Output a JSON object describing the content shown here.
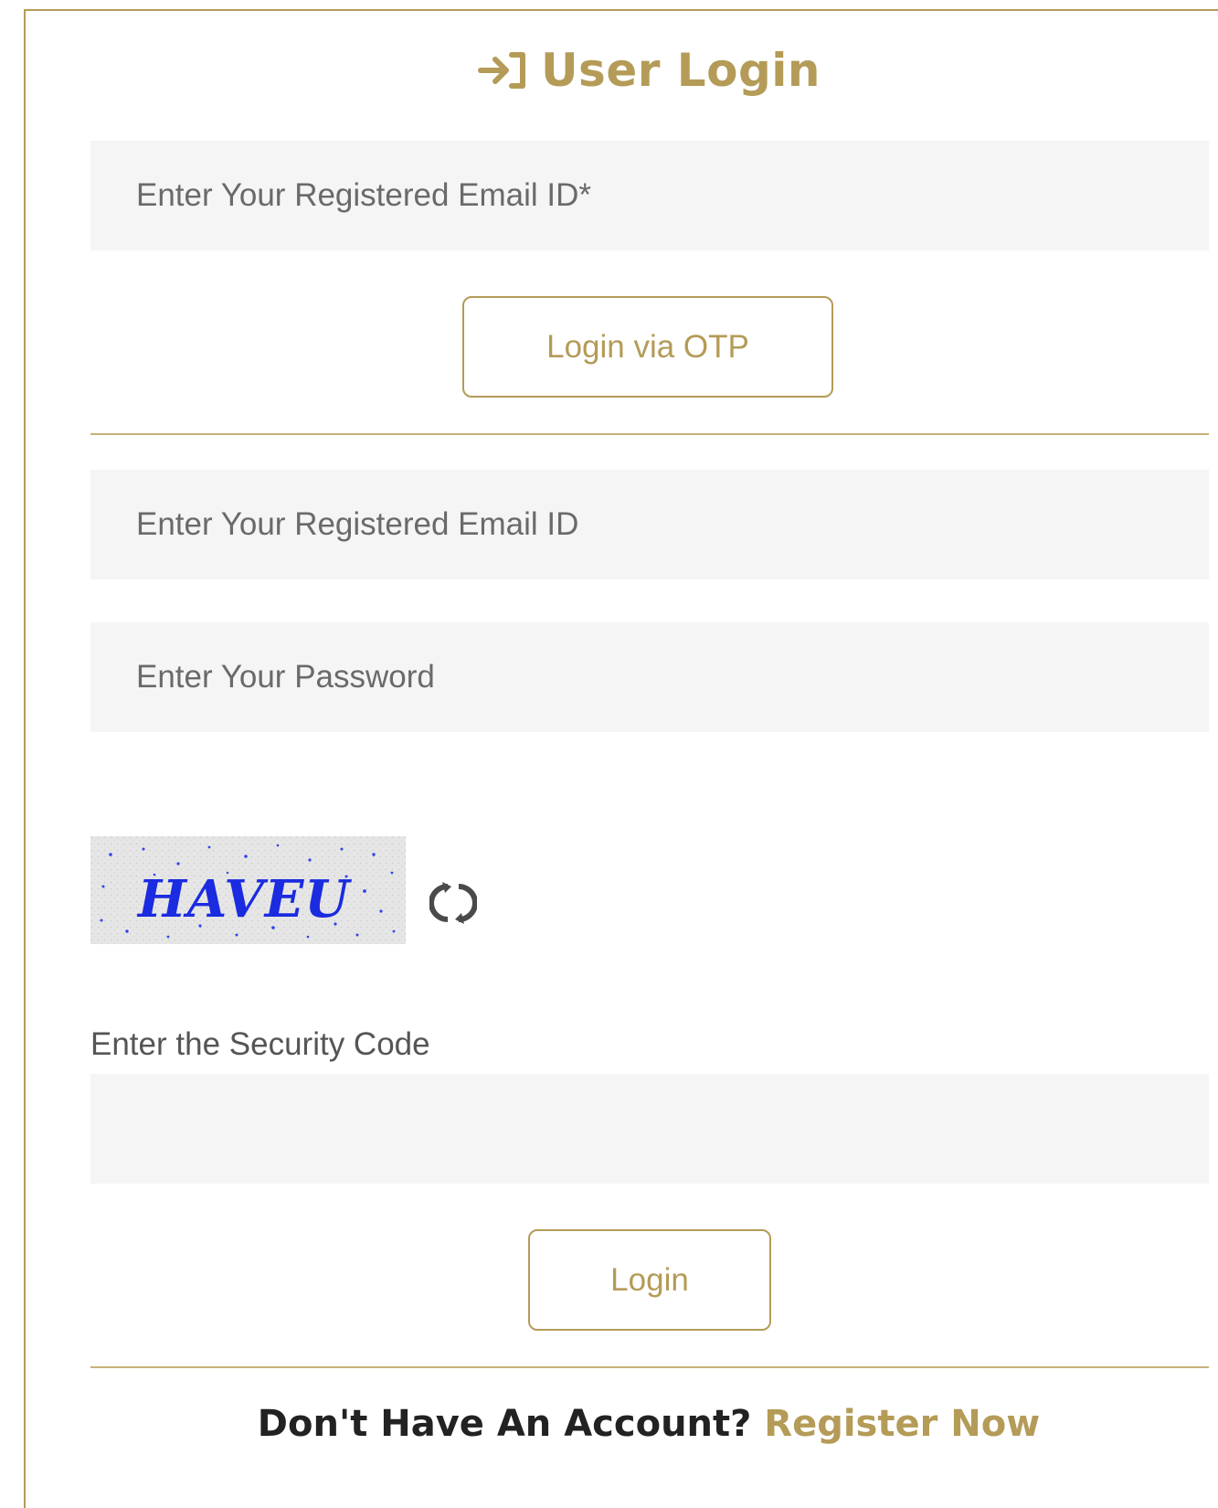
{
  "header": {
    "title": "User Login",
    "icon": "login-arrow-icon"
  },
  "otp_section": {
    "email_placeholder": "Enter Your Registered Email ID*",
    "otp_button_label": "Login via OTP"
  },
  "password_section": {
    "email_placeholder": "Enter Your Registered Email ID",
    "password_placeholder": "Enter Your Password"
  },
  "captcha": {
    "code": "HAVEU",
    "refresh_icon": "refresh-icon",
    "label": "Enter the Security Code",
    "input_value": ""
  },
  "login_button_label": "Login",
  "footer": {
    "question": "Don't Have An Account? ",
    "register_link": "Register Now"
  },
  "colors": {
    "accent": "#b49b57",
    "field_bg": "#f5f5f5",
    "captcha_text": "#1a2be0"
  }
}
